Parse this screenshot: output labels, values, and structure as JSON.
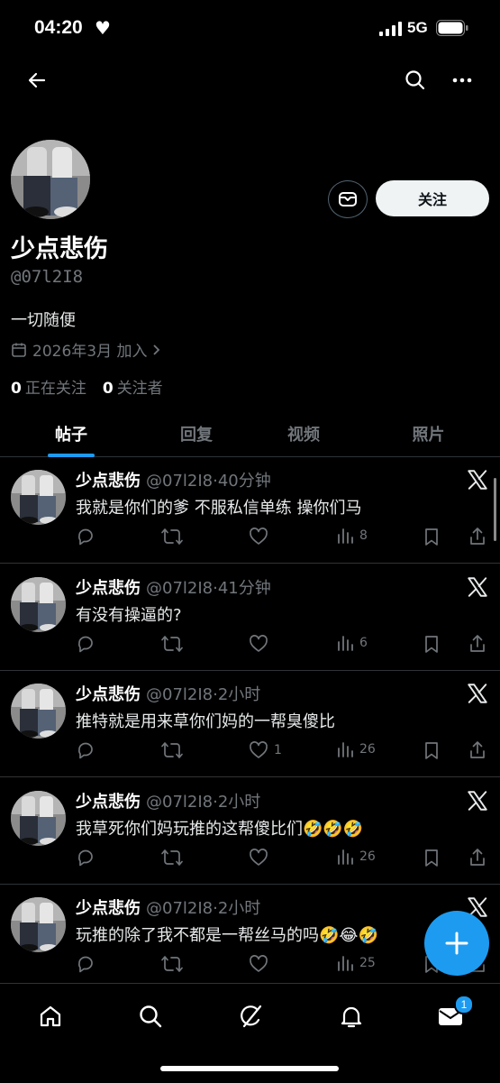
{
  "status_bar": {
    "time": "04:20",
    "network": "5G"
  },
  "profile": {
    "display_name": "少点悲伤",
    "handle": "@07l2I8",
    "bio": "一切随便",
    "joined": "2026年3月 加入",
    "following_count": "0",
    "following_label": "正在关注",
    "followers_count": "0",
    "followers_label": "关注者",
    "follow_button": "关注"
  },
  "tabs": [
    {
      "label": "帖子",
      "active": true
    },
    {
      "label": "回复",
      "active": false
    },
    {
      "label": "视频",
      "active": false
    },
    {
      "label": "照片",
      "active": false
    }
  ],
  "posts": [
    {
      "name": "少点悲伤",
      "handle": "@07l2I8",
      "time": "40分钟",
      "text": "我就是你们的爹 不服私信单练 操你们马",
      "likes": "",
      "views": "8"
    },
    {
      "name": "少点悲伤",
      "handle": "@07l2I8",
      "time": "41分钟",
      "text": "有没有操逼的?",
      "likes": "",
      "views": "6"
    },
    {
      "name": "少点悲伤",
      "handle": "@07l2I8",
      "time": "2小时",
      "text": "推特就是用来草你们妈的一帮臭傻比",
      "likes": "1",
      "views": "26"
    },
    {
      "name": "少点悲伤",
      "handle": "@07l2I8",
      "time": "2小时",
      "text": "我草死你们妈玩推的这帮傻比们🤣🤣🤣",
      "likes": "",
      "views": "26"
    },
    {
      "name": "少点悲伤",
      "handle": "@07l2I8",
      "time": "2小时",
      "text": "玩推的除了我不都是一帮丝马的吗🤣😂🤣",
      "likes": "",
      "views": "25"
    }
  ],
  "bottom_nav": {
    "messages_badge": "1"
  },
  "colors": {
    "accent": "#1d9bf0",
    "background": "#000000",
    "muted": "#71767b"
  }
}
